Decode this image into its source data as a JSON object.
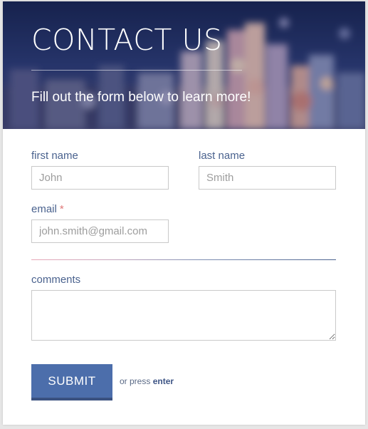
{
  "header": {
    "title": "CONTACT US",
    "subtitle": "Fill out the form below to learn more!"
  },
  "form": {
    "first_name": {
      "label": "first name",
      "placeholder": "John"
    },
    "last_name": {
      "label": "last name",
      "placeholder": "Smith"
    },
    "email": {
      "label": "email",
      "required_marker": "*",
      "placeholder": "john.smith@gmail.com"
    },
    "comments": {
      "label": "comments",
      "value": ""
    },
    "submit_label": "SUBMIT",
    "hint_prefix": "or press",
    "hint_key": "enter"
  },
  "colors": {
    "accent": "#4c6eab",
    "label_text": "#4a628e",
    "required": "#e07878"
  }
}
